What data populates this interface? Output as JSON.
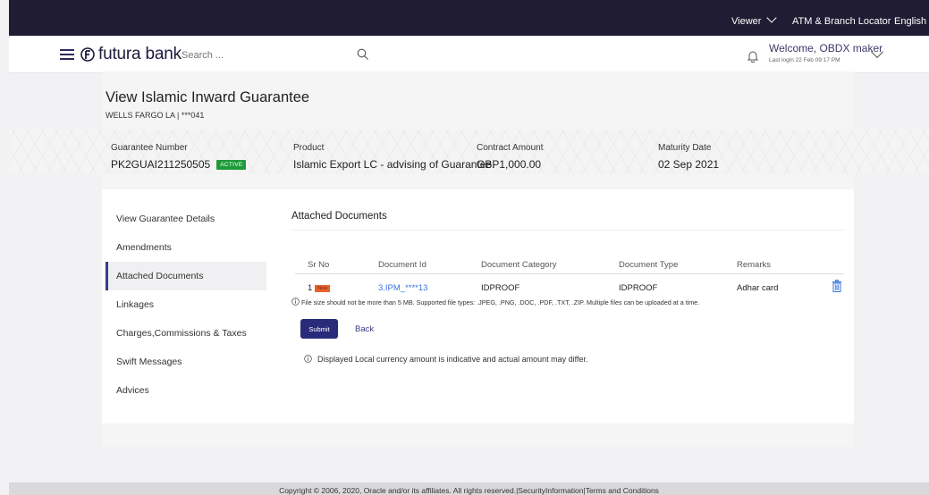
{
  "topbar": {
    "viewer": "Viewer",
    "atm_locator": "ATM & Branch Locator",
    "language": "English"
  },
  "header": {
    "brand": "futura bank",
    "search_placeholder": "Search ...",
    "welcome": "Welcome, OBDX maker",
    "last_login": "Last login 22 Feb 09:17 PM"
  },
  "page": {
    "title": "View Islamic Inward Guarantee",
    "subtitle": "WELLS FARGO LA | ***041"
  },
  "summary": {
    "guarantee_number_label": "Guarantee Number",
    "guarantee_number": "PK2GUAI211250505",
    "status": "ACTIVE",
    "product_label": "Product",
    "product": "Islamic Export LC - advising of Guarantee.",
    "amount_label": "Contract Amount",
    "amount": "GBP1,000.00",
    "maturity_label": "Maturity Date",
    "maturity": "02 Sep 2021"
  },
  "nav": {
    "items": [
      "View Guarantee Details",
      "Amendments",
      "Attached Documents",
      "Linkages",
      "Charges,Commissions & Taxes",
      "Swift Messages",
      "Advices"
    ],
    "active": "Attached Documents"
  },
  "documents": {
    "title": "Attached Documents",
    "columns": [
      "Sr No",
      "Document Id",
      "Document Category",
      "Document Type",
      "Remarks"
    ],
    "rows": [
      {
        "sr": "1",
        "new_badge": "New",
        "doc_id": "3.IPM_****13",
        "category": "IDPROOF",
        "type": "IDPROOF",
        "remarks": "Adhar card"
      }
    ],
    "file_note": "File size should not be more than 5 MB. Supported file types: .JPEG, .PNG, .DOC, .PDF, .TXT, .ZIP. Multiple files can be uploaded at a time."
  },
  "actions": {
    "submit": "Submit",
    "back": "Back"
  },
  "disclaimer": "Displayed Local currency amount is indicative and actual amount may differ.",
  "footer": "Copyright © 2006, 2020, Oracle and/or its affiliates. All rights reserved.|SecurityInformation|Terms and Conditions",
  "colors": {
    "topbar": "#1f1c33",
    "primary_button": "#2a2a7a",
    "link": "#3a74d9",
    "active_badge": "#1f9a3a",
    "new_badge": "#e8622b"
  }
}
